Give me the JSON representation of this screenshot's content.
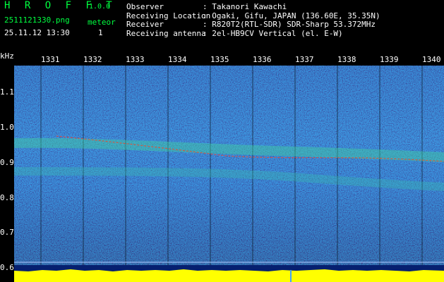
{
  "header": {
    "brand": "H R O F F T",
    "version": "1.0.0",
    "filename": "2511121330.png",
    "datetime": "25.11.12 13:30",
    "meteor_label": "meteor",
    "meteor_count": "1",
    "info": [
      {
        "key": "Observer",
        "value": "Takanori Kawachi"
      },
      {
        "key": "Receiving Location",
        "value": "Ogaki, Gifu, JAPAN (136.60E, 35.35N)"
      },
      {
        "key": "Receiver",
        "value": "R820T2(RTL-SDR) SDR-Sharp 53.372MHz"
      },
      {
        "key": "Receiving antenna",
        "value": "2el-HB9CV Vertical (el. E-W)"
      }
    ]
  },
  "axes": {
    "y_unit": "kHz",
    "x_ticks": [
      "1331",
      "1332",
      "1333",
      "1334",
      "1335",
      "1336",
      "1337",
      "1338",
      "1339",
      "1340"
    ],
    "y_ticks": [
      "1.1",
      "1.0",
      "0.9",
      "0.8",
      "0.7",
      "0.6"
    ]
  },
  "colors": {
    "brand": "#00ff40",
    "background": "#0a2a8a",
    "signal_trace": "#ff4020",
    "noise_bar": "#ffff00"
  }
}
